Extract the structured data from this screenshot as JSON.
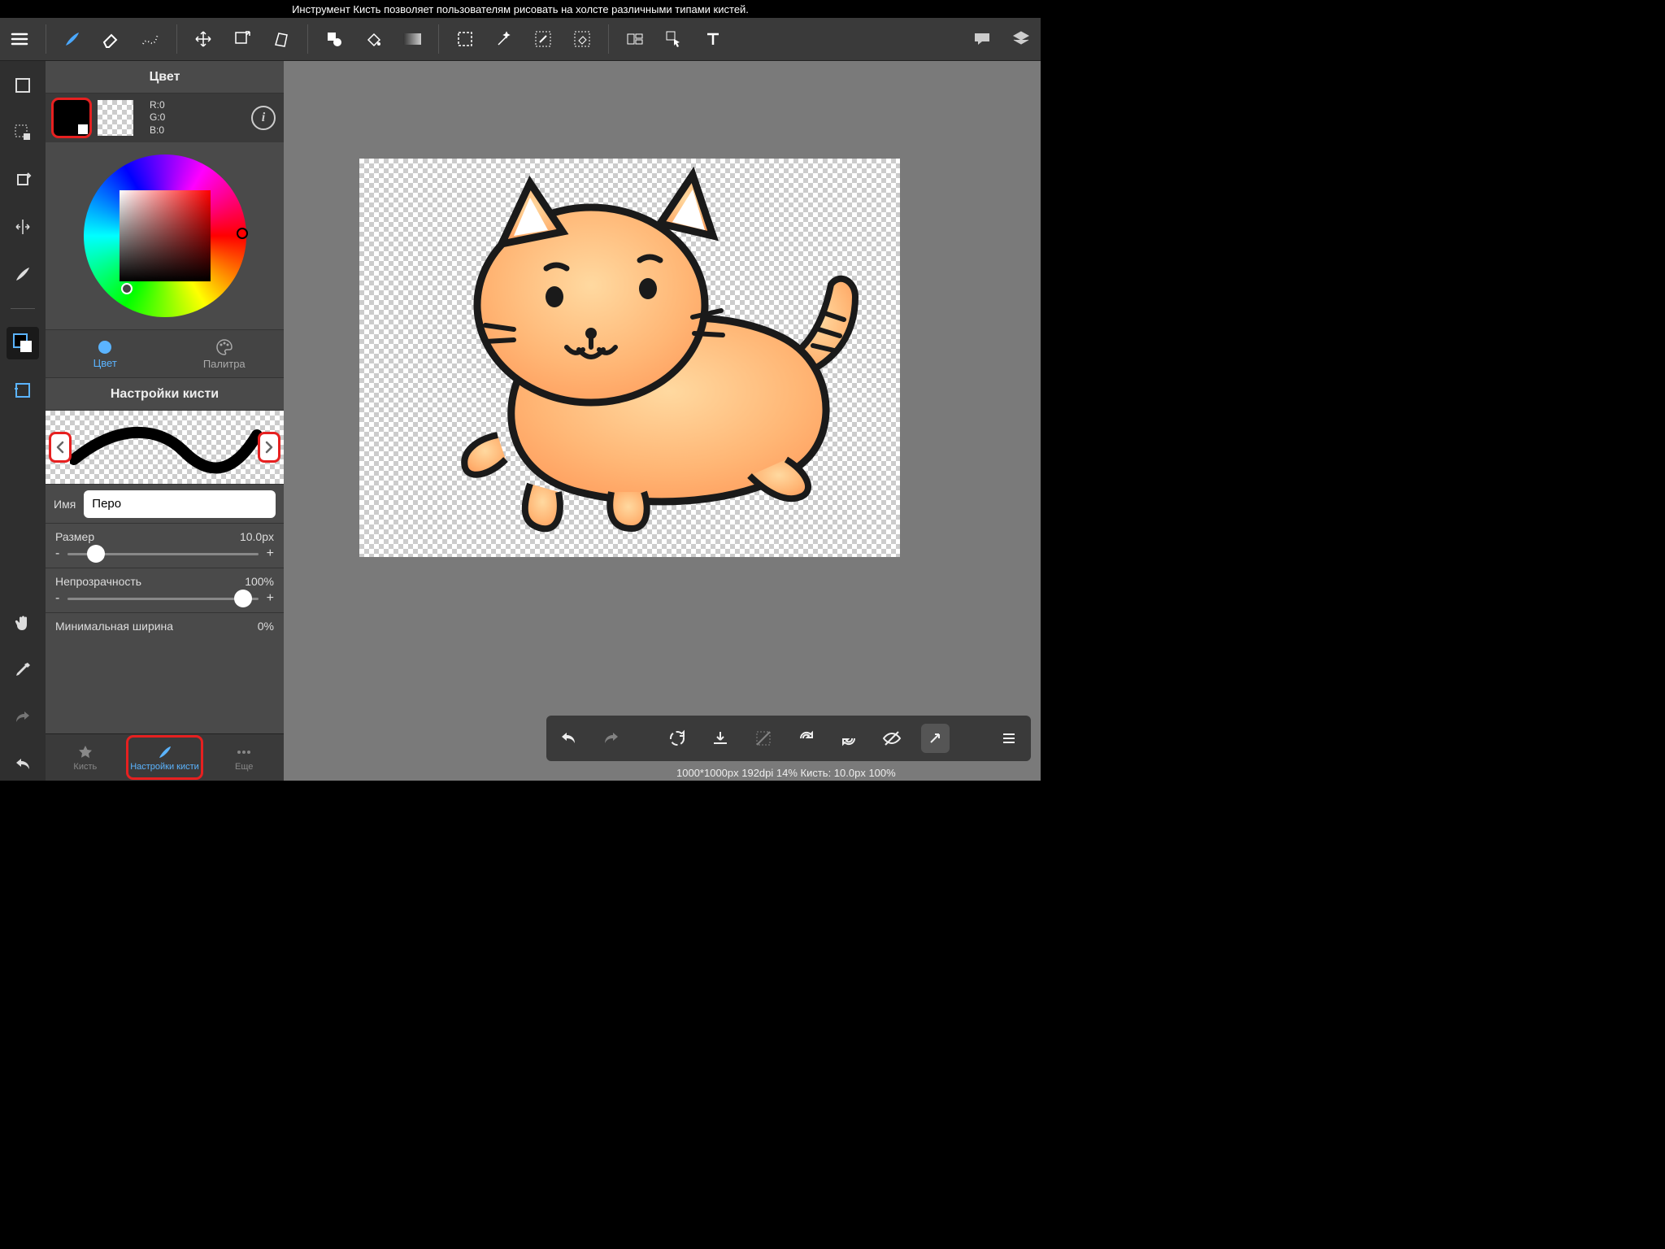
{
  "tooltip": "Инструмент Кисть позволяет пользователям рисовать на холсте различными типами кистей.",
  "color_panel": {
    "title": "Цвет",
    "rgb": {
      "r_label": "R:0",
      "g_label": "G:0",
      "b_label": "B:0"
    },
    "tabs": {
      "color": "Цвет",
      "palette": "Палитра"
    }
  },
  "brush_panel": {
    "title": "Настройки кисти",
    "name_label": "Имя",
    "name_value": "Перо",
    "size": {
      "label": "Размер",
      "value": "10.0px"
    },
    "opacity": {
      "label": "Непрозрачность",
      "value": "100%"
    },
    "min_width": {
      "label": "Минимальная ширина",
      "value": "0%"
    }
  },
  "bottom_tabs": {
    "brush": "Кисть",
    "settings": "Настройки кисти",
    "more": "Еще"
  },
  "status": "1000*1000px 192dpi 14% Кисть: 10.0px 100%",
  "slider_minus": "-",
  "slider_plus": "+"
}
